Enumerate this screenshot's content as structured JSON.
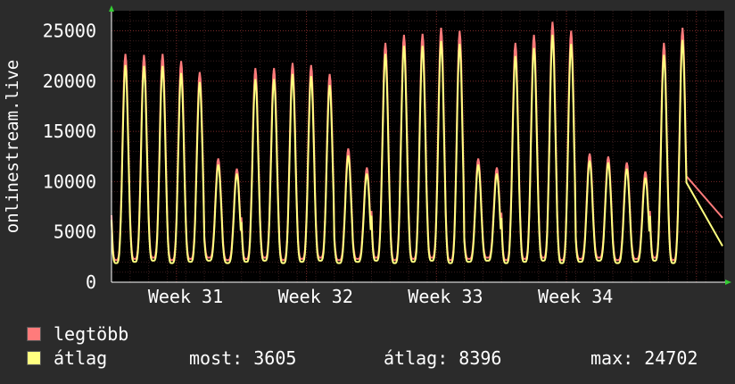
{
  "chart_data": {
    "type": "line",
    "ylabel": "onlinestream.live",
    "ylim": [
      0,
      27000
    ],
    "y_ticks": [
      0,
      5000,
      10000,
      15000,
      20000,
      25000
    ],
    "x_ticks": [
      "Week 31",
      "Week 32",
      "Week 33",
      "Week 34"
    ],
    "grid": true,
    "x_range_days": [
      0,
      33
    ],
    "series": [
      {
        "name": "legtöbb",
        "color": "#ff7b7b",
        "daily_peaks": [
          22700,
          22600,
          22700,
          22000,
          20900,
          12300,
          11300,
          21300,
          21300,
          21800,
          21600,
          20700,
          13300,
          11400,
          23800,
          24600,
          24700,
          25300,
          25000,
          12300,
          11400,
          23800,
          24600,
          25900,
          25000,
          12800,
          12500,
          11900,
          11000,
          23800,
          25300
        ]
      },
      {
        "name": "átlag",
        "color": "#ffff80",
        "daily_peaks": [
          21600,
          21500,
          21500,
          20800,
          19900,
          11700,
          10800,
          20200,
          20200,
          20700,
          20500,
          19600,
          12600,
          10800,
          22700,
          23500,
          23500,
          24000,
          23700,
          11700,
          10800,
          22500,
          23300,
          24600,
          23700,
          12100,
          11900,
          11300,
          10400,
          22600,
          24100
        ]
      }
    ],
    "last_value": 6400
  },
  "legend": [
    {
      "label": "legtöbb",
      "color": "#ff7b7b"
    },
    {
      "label": "átlag",
      "color": "#ffff80"
    }
  ],
  "stats": {
    "most": "most: 3605",
    "atlag": "átlag: 8396",
    "max": "max: 24702"
  }
}
